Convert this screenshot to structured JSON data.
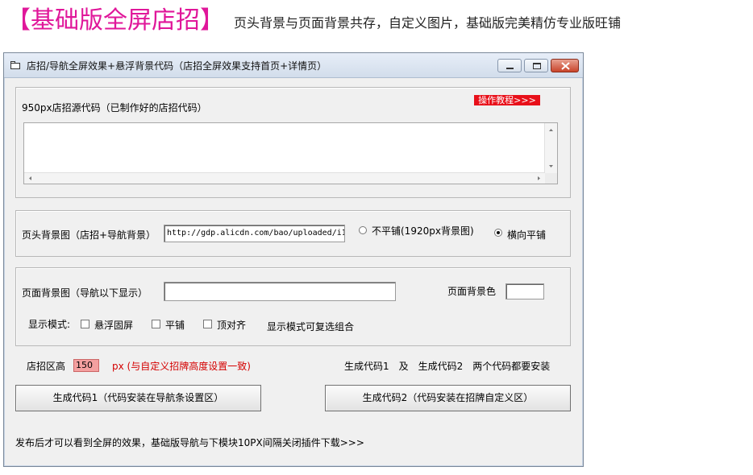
{
  "banner": {
    "title": "【基础版全屏店招】",
    "subtitle": "页头背景与页面背景共存，自定义图片，基础版完美精仿专业版旺铺"
  },
  "window": {
    "title": "店招/导航全屏效果+悬浮背景代码（店招全屏效果支持首页+详情页）"
  },
  "source_section": {
    "label": "950px店招源代码（已制作好的店招代码）",
    "tutorial_label": "操作教程>>>",
    "code_value": ""
  },
  "header_bg": {
    "label": "页头背景图（店招+导航背景）",
    "url_value": "http://gdp.alicdn.com/bao/uploaded/i1",
    "radio_no_tile_label": "不平铺(1920px背景图)",
    "radio_h_tile_label": "横向平铺",
    "selected": "横向平铺"
  },
  "page_bg": {
    "label": "页面背景图（导航以下显示）",
    "url_value": "",
    "color_label": "页面背景色",
    "color_value": "",
    "display_mode_label": "显示模式:",
    "opt_float": "悬浮固屏",
    "opt_tile": "平铺",
    "opt_top": "顶对齐",
    "mode_note": "显示模式可复选组合"
  },
  "height_row": {
    "label": "店招区高",
    "value": "150",
    "note": "px (与自定义招牌高度设置一致)",
    "right_note": "生成代码1　及　生成代码2　两个代码都要安装"
  },
  "buttons": {
    "gen1": "生成代码1（代码安装在导航条设置区）",
    "gen2": "生成代码2（代码安装在招牌自定义区）"
  },
  "footer": {
    "text": "发布后才可以看到全屏的效果，基础版导航与下模块10PX间隔关闭插件下载>>>"
  },
  "colors": {
    "banner_title": "#e0179a",
    "tutorial_bg": "#e8101a",
    "height_value_bg": "#f4a0a0",
    "note_red": "#d40000"
  }
}
